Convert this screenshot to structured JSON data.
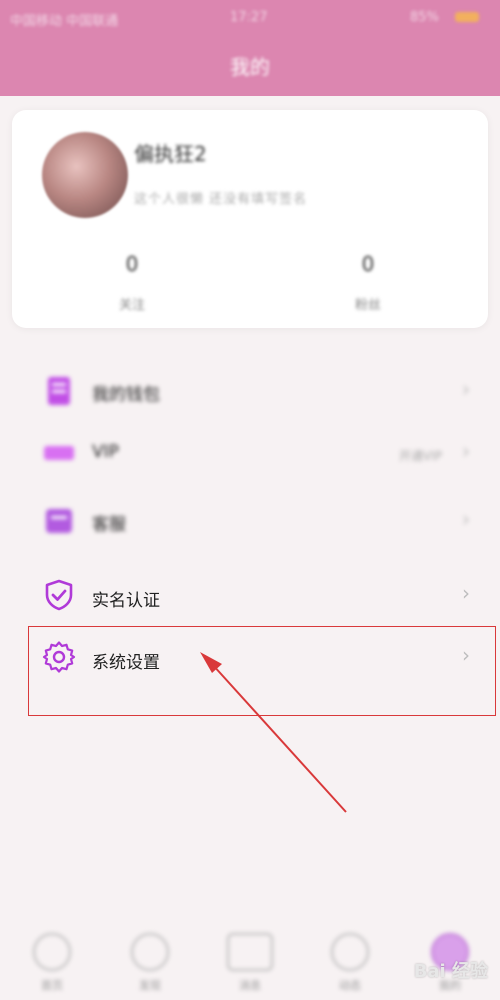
{
  "status_bar": {
    "carrier": "中国移动 中国联通",
    "time": "17:27",
    "battery": "85%"
  },
  "header": {
    "title": "我的"
  },
  "profile": {
    "nickname": "偏执狂2",
    "bio": "这个人很懒 还没有填写签名",
    "stats": [
      {
        "value": "0",
        "label": "关注"
      },
      {
        "value": "0",
        "label": "粉丝"
      }
    ]
  },
  "menu": {
    "items": [
      {
        "label": "我的钱包",
        "value": "",
        "icon": "wallet-icon"
      },
      {
        "label": "VIP",
        "value": "开通VIP",
        "icon": "vip-icon"
      },
      {
        "label": "客服",
        "value": "",
        "icon": "support-icon"
      },
      {
        "label": "实名认证",
        "value": "",
        "icon": "shield-check-icon"
      },
      {
        "label": "系统设置",
        "value": "",
        "icon": "gear-icon"
      }
    ]
  },
  "tabbar": {
    "items": [
      {
        "label": "首页",
        "icon": "home-icon"
      },
      {
        "label": "发现",
        "icon": "bulb-icon"
      },
      {
        "label": "消息",
        "icon": "message-icon"
      },
      {
        "label": "动态",
        "icon": "play-icon"
      },
      {
        "label": "我的",
        "icon": "profile-icon"
      }
    ]
  },
  "watermark": {
    "text": "Bai 经验"
  },
  "colors": {
    "header_bg": "#dc86b0",
    "accent_purple": "#b03ad8",
    "highlight_border": "#d9393a",
    "arrow": "#d9393a"
  }
}
